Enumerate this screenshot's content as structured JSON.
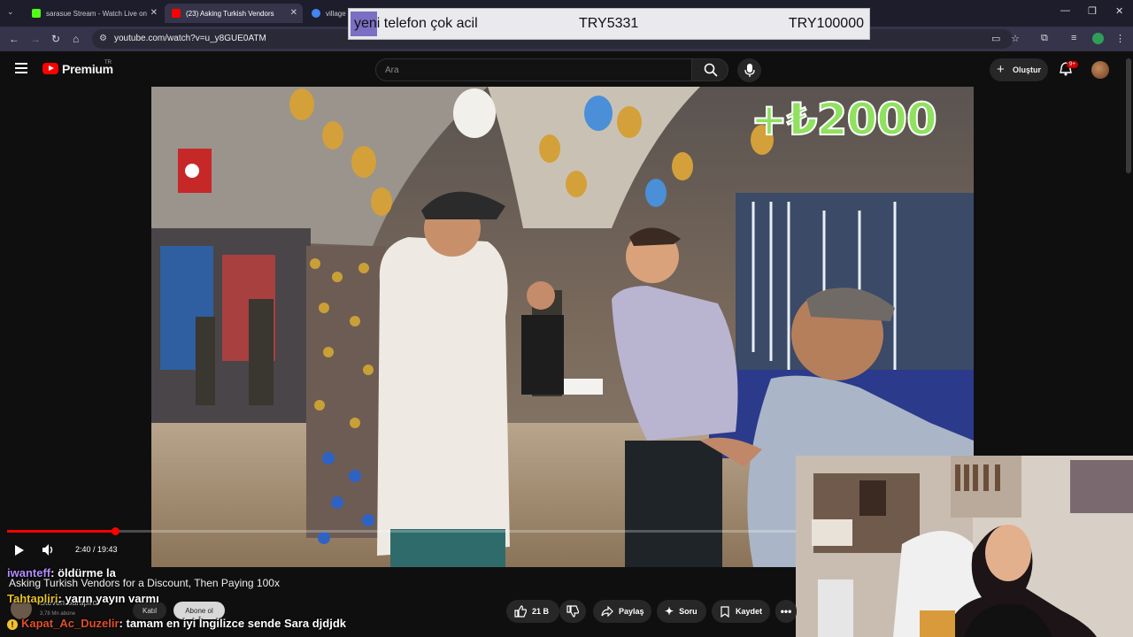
{
  "browser": {
    "tabs": [
      {
        "label": "sarasue Stream - Watch Live on",
        "favicon_color": "#53fc18"
      },
      {
        "label": "(23) Asking Turkish Vendors",
        "favicon_color": "#ff0000"
      },
      {
        "label": "village l",
        "favicon_color": "#4285f4"
      }
    ],
    "url": "youtube.com/watch?v=u_y8GUE0ATM"
  },
  "donation_bar": {
    "message": "yeni telefon çok acil",
    "current": "TRY5331",
    "goal": "TRY100000"
  },
  "youtube": {
    "logo_text": "Premium",
    "logo_sup": "TR",
    "search_placeholder": "Ara",
    "create_label": "Oluştur",
    "notification_count": "9+"
  },
  "video": {
    "overlay_text": "+₺2000",
    "time_display": "2:40 / 19:43",
    "progress": 0.137,
    "title": "Asking Turkish Vendors for a Discount, Then Paying 100x",
    "channel": "Steven Saraplro",
    "subscribers": "3,78 Mn abone",
    "join_label": "Katıl",
    "subscribe_label": "Abone ol"
  },
  "actions": {
    "likes": "21 B",
    "share": "Paylaş",
    "ask": "Soru",
    "save": "Kaydet"
  },
  "chat": [
    {
      "user": "iwanteff",
      "color": "#b48cff",
      "message": ": öldürme la"
    },
    {
      "user": "Tahtapliri",
      "color": "#e6c229",
      "message": ": yarın yayın varmı"
    },
    {
      "user": "Kapat_Ac_Duzelir",
      "color": "#e04f2b",
      "message": ": tamam en iyi İngilizce sende Sara djdjdk"
    }
  ]
}
